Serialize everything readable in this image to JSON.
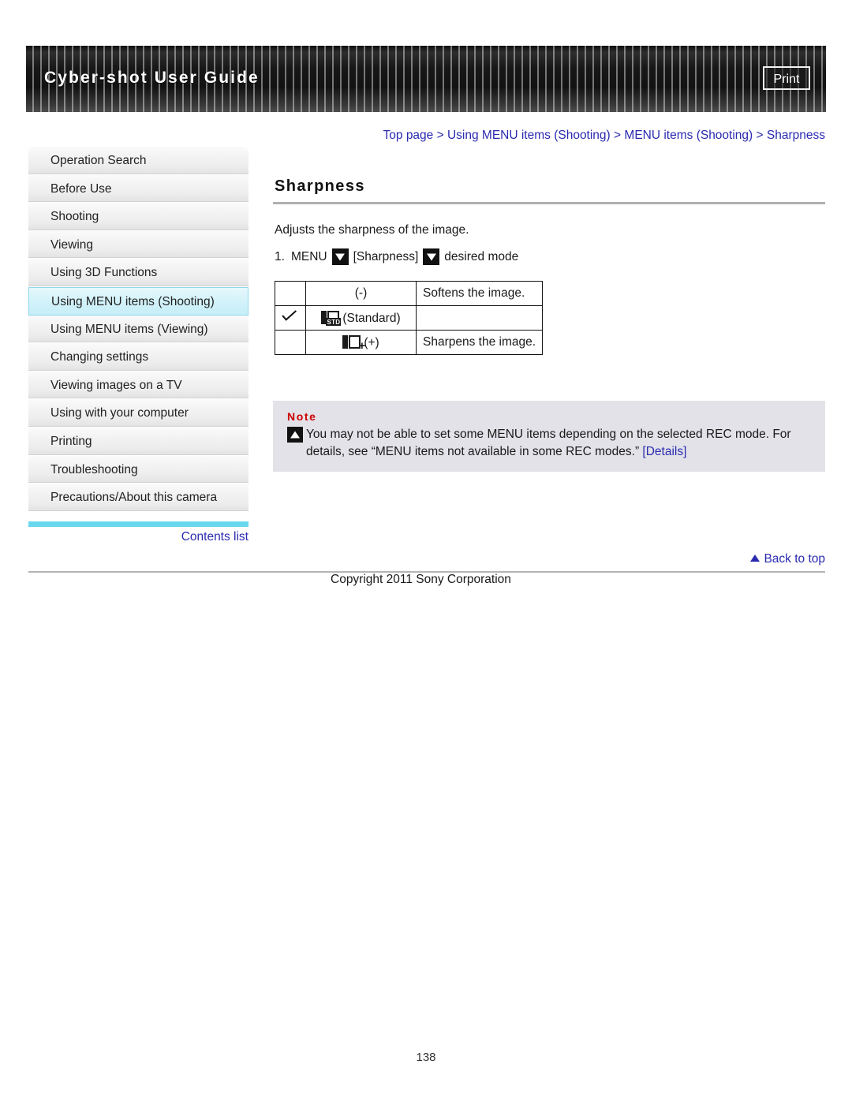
{
  "header": {
    "title": "Cyber-shot User Guide",
    "print_label": "Print"
  },
  "breadcrumb": {
    "items": [
      "Top page",
      "Using MENU items (Shooting)",
      "MENU items (Shooting)",
      "Sharpness"
    ],
    "separator": ">",
    "full_text": "Top page > Using MENU items (Shooting) > MENU items (Shooting) > Sharpness"
  },
  "sidebar": {
    "items": [
      {
        "label": "Operation Search",
        "active": false
      },
      {
        "label": "Before Use",
        "active": false
      },
      {
        "label": "Shooting",
        "active": false
      },
      {
        "label": "Viewing",
        "active": false
      },
      {
        "label": "Using 3D Functions",
        "active": false
      },
      {
        "label": "Using MENU items (Shooting)",
        "active": true
      },
      {
        "label": "Using MENU items (Viewing)",
        "active": false
      },
      {
        "label": "Changing settings",
        "active": false
      },
      {
        "label": "Viewing images on a TV",
        "active": false
      },
      {
        "label": "Using with your computer",
        "active": false
      },
      {
        "label": "Printing",
        "active": false
      },
      {
        "label": "Troubleshooting",
        "active": false
      },
      {
        "label": "Precautions/About this camera",
        "active": false
      }
    ],
    "contents_list_label": "Contents list",
    "accent_color": "#69d8ef"
  },
  "main": {
    "heading": "Sharpness",
    "description": "Adjusts the sharpness of the image.",
    "step": {
      "number": "1.",
      "part1": "MENU",
      "part2": "[Sharpness]",
      "part3": "desired mode"
    },
    "table": {
      "rows": [
        {
          "checked": false,
          "icon": "none",
          "label": "(-)",
          "description": "Softens the image."
        },
        {
          "checked": true,
          "icon": "sharp-std",
          "label": "(Standard)",
          "description": ""
        },
        {
          "checked": false,
          "icon": "sharp-plus",
          "label": "(+)",
          "description": "Sharpens the image."
        }
      ],
      "icon_std_tag": "STD",
      "icon_plus_tag": "+"
    },
    "note": {
      "title": "Note",
      "text_before_link": "You may not be able to set some MENU items depending on the selected REC mode. For details, see “MENU items not available in some REC modes.” ",
      "link_label": "[Details]"
    }
  },
  "footer": {
    "back_to_top_label": "Back to top",
    "copyright": "Copyright 2011 Sony Corporation",
    "page_number": "138"
  },
  "colors": {
    "link": "#2a2ab0",
    "note_title": "#cc0000",
    "note_background": "#e2e2e8",
    "accent_cyan": "#69d8ef",
    "active_nav": "#d3f2fa"
  }
}
